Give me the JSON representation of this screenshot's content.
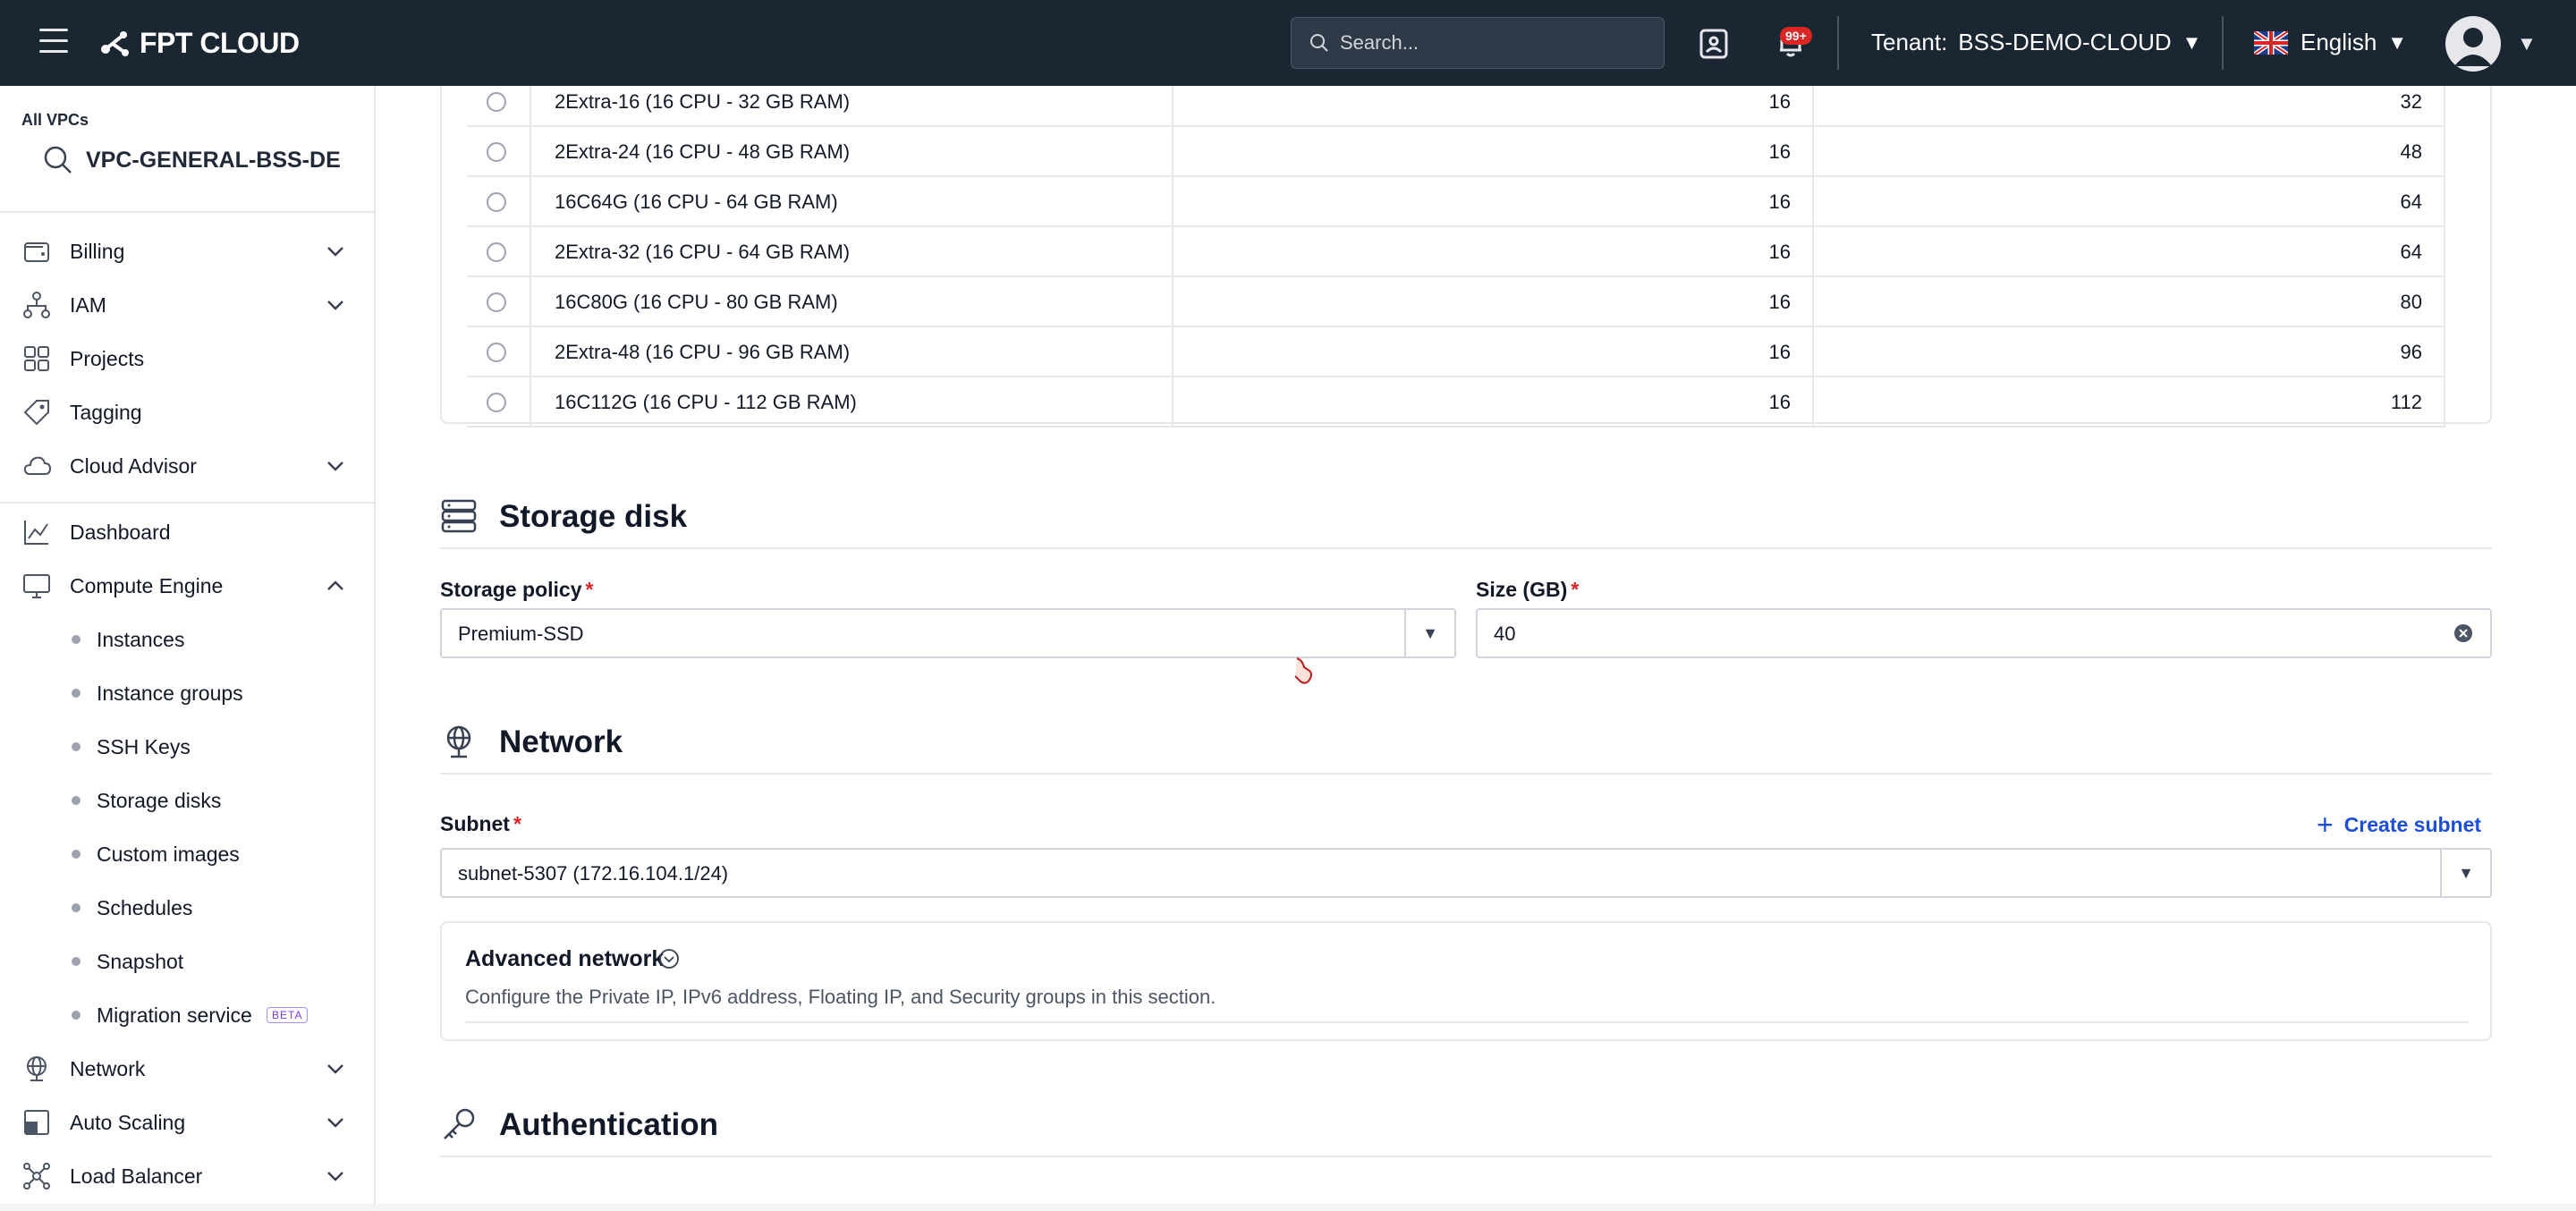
{
  "topbar": {
    "logo_text": "FPT CLOUD",
    "search_placeholder": "Search...",
    "notification_badge": "99+",
    "tenant_label": "Tenant:",
    "tenant_value": "BSS-DEMO-CLOUD",
    "language": "English"
  },
  "sidebar": {
    "vpc_label": "All VPCs",
    "vpc_name": "VPC-GENERAL-BSS-DE",
    "items": [
      {
        "label": "Billing",
        "icon": "wallet-icon",
        "expandable": true
      },
      {
        "label": "IAM",
        "icon": "hierarchy-icon",
        "expandable": true
      },
      {
        "label": "Projects",
        "icon": "projects-icon",
        "expandable": false
      },
      {
        "label": "Tagging",
        "icon": "tag-icon",
        "expandable": false
      },
      {
        "label": "Cloud Advisor",
        "icon": "cloud-icon",
        "expandable": true
      },
      {
        "label": "Dashboard",
        "icon": "chart-icon",
        "expandable": false
      },
      {
        "label": "Compute Engine",
        "icon": "monitor-icon",
        "expanded": true
      }
    ],
    "compute_sub": [
      {
        "label": "Instances"
      },
      {
        "label": "Instance groups"
      },
      {
        "label": "SSH Keys"
      },
      {
        "label": "Storage disks"
      },
      {
        "label": "Custom images"
      },
      {
        "label": "Schedules"
      },
      {
        "label": "Snapshot"
      },
      {
        "label": "Migration service",
        "badge": "BETA"
      }
    ],
    "bottom_items": [
      {
        "label": "Network",
        "icon": "globe-icon"
      },
      {
        "label": "Auto Scaling",
        "icon": "scaling-icon"
      },
      {
        "label": "Load Balancer",
        "icon": "load-balancer-icon"
      }
    ]
  },
  "flavor_table": {
    "rows": [
      {
        "name": "2Extra-16 (16 CPU - 32 GB RAM)",
        "cpu": "16",
        "ram": "32"
      },
      {
        "name": "2Extra-24 (16 CPU - 48 GB RAM)",
        "cpu": "16",
        "ram": "48"
      },
      {
        "name": "16C64G (16 CPU - 64 GB RAM)",
        "cpu": "16",
        "ram": "64"
      },
      {
        "name": "2Extra-32 (16 CPU - 64 GB RAM)",
        "cpu": "16",
        "ram": "64"
      },
      {
        "name": "16C80G (16 CPU - 80 GB RAM)",
        "cpu": "16",
        "ram": "80"
      },
      {
        "name": "2Extra-48 (16 CPU - 96 GB RAM)",
        "cpu": "16",
        "ram": "96"
      },
      {
        "name": "16C112G (16 CPU - 112 GB RAM)",
        "cpu": "16",
        "ram": "112"
      }
    ]
  },
  "storage": {
    "title": "Storage disk",
    "policy_label": "Storage policy",
    "policy_value": "Premium-SSD",
    "size_label": "Size (GB)",
    "size_value": "40"
  },
  "network": {
    "title": "Network",
    "subnet_label": "Subnet",
    "subnet_value": "subnet-5307 (172.16.104.1/24)",
    "create_subnet": "Create subnet",
    "advanced_title": "Advanced network",
    "advanced_desc": "Configure the Private IP, IPv6 address, Floating IP, and Security groups in this section."
  },
  "authentication": {
    "title": "Authentication"
  },
  "required_mark": "*",
  "colors": {
    "topbar": "#1b2633",
    "accent_link": "#1d4ed8",
    "required": "#dc2626",
    "badge": "#dc2626"
  }
}
